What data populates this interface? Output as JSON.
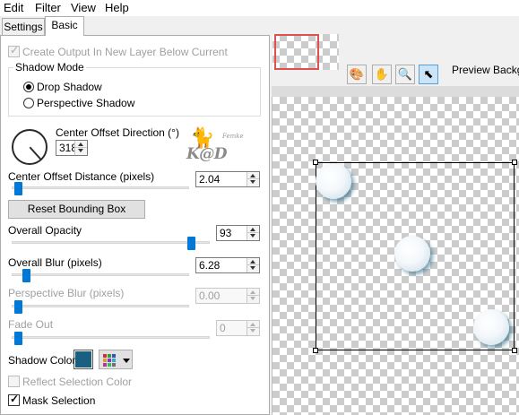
{
  "menu": {
    "items": [
      "Edit",
      "Filter",
      "View",
      "Help"
    ]
  },
  "tabs": {
    "settings": "Settings",
    "basic": "Basic"
  },
  "options": {
    "create_output_label": "Create Output In New Layer Below Current",
    "shadow_mode": {
      "title": "Shadow Mode",
      "drop_shadow": "Drop Shadow",
      "perspective_shadow": "Perspective Shadow",
      "selected": "Drop Shadow"
    },
    "center_offset_direction": {
      "label": "Center Offset Direction (°)",
      "value": "318"
    },
    "center_offset_distance": {
      "label": "Center Offset Distance (pixels)",
      "value": "2.04"
    },
    "reset_button": "Reset Bounding Box",
    "overall_opacity": {
      "label": "Overall Opacity",
      "value": "93"
    },
    "overall_blur": {
      "label": "Overall Blur (pixels)",
      "value": "6.28"
    },
    "perspective_blur": {
      "label": "Perspective Blur (pixels)",
      "value": "0.00"
    },
    "fade_out": {
      "label": "Fade Out",
      "value": "0"
    },
    "shadow_color": {
      "label": "Shadow Color",
      "color": "#1a5f80"
    },
    "reflect_selection_color": "Reflect Selection Color",
    "mask_selection": "Mask Selection"
  },
  "logo": {
    "text": "K@D",
    "small": "Femke"
  },
  "toolbar": {
    "preview_label": "Preview Backgr",
    "icons": [
      "palette-picker-icon",
      "hand-icon",
      "zoom-icon",
      "arrow-pointer-icon"
    ]
  }
}
